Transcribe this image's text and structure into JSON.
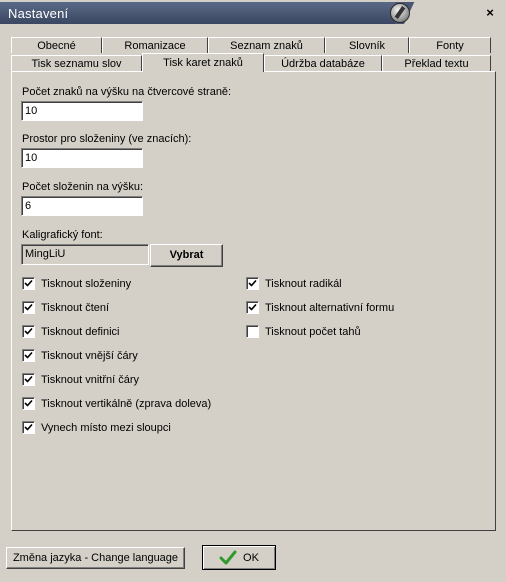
{
  "window": {
    "title": "Nastavení",
    "close": "×"
  },
  "tabs_row1": [
    "Obecné",
    "Romanizace",
    "Seznam znaků",
    "Slovník",
    "Fonty"
  ],
  "tabs_row2": [
    "Tisk seznamu slov",
    "Tisk karet znaků",
    "Údržba databáze",
    "Překlad textu"
  ],
  "active_tab": "Tisk karet znaků",
  "form": {
    "chars_label": "Počet znaků na výšku na čtvercové straně:",
    "chars_value": "10",
    "space_label": "Prostor pro složeniny (ve znacích):",
    "space_value": "10",
    "compounds_label": "Počet složenin na výšku:",
    "compounds_value": "6",
    "font_label": "Kaligrafický font:",
    "font_value": "MingLiU",
    "choose_button": "Vybrat"
  },
  "checkboxes_left": [
    {
      "label": "Tisknout složeniny",
      "checked": true
    },
    {
      "label": "Tisknout čtení",
      "checked": true
    },
    {
      "label": "Tisknout definici",
      "checked": true
    },
    {
      "label": "Tisknout vnější čáry",
      "checked": true
    },
    {
      "label": "Tisknout vnitřní čáry",
      "checked": true
    },
    {
      "label": "Tisknout vertikálně (zprava doleva)",
      "checked": true
    },
    {
      "label": "Vynech místo mezi sloupci",
      "checked": true
    }
  ],
  "checkboxes_right": [
    {
      "label": "Tisknout radikál",
      "checked": true
    },
    {
      "label": "Tisknout alternativní formu",
      "checked": true
    },
    {
      "label": "Tisknout počet tahů",
      "checked": false
    }
  ],
  "footer": {
    "language_button": "Změna jazyka - Change language",
    "ok_button": "OK"
  },
  "colors": {
    "check_green": "#2e9a2e",
    "title_bg": "#4a5672"
  }
}
